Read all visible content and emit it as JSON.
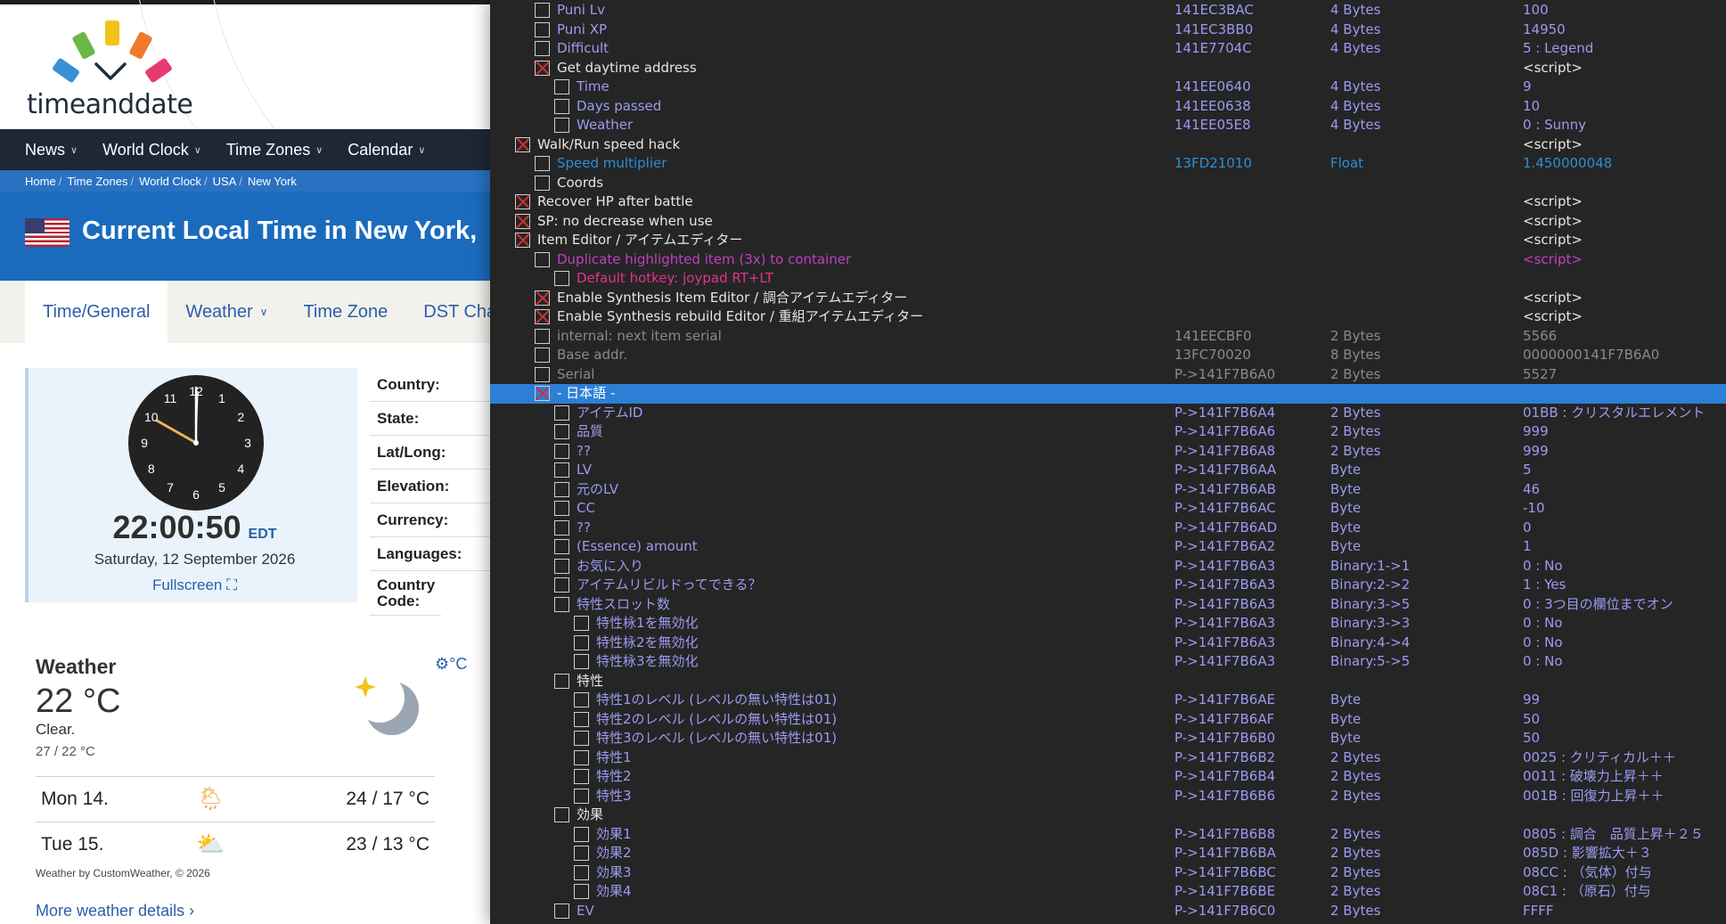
{
  "site": {
    "logo_text": "timeanddate",
    "logo_colors": [
      "#3a8fd6",
      "#6ab84a",
      "#f3c21b",
      "#f0792b",
      "#e63b6f"
    ],
    "nav": [
      "News",
      "World Clock",
      "Time Zones",
      "Calendar"
    ],
    "breadcrumbs": [
      "Home",
      "Time Zones",
      "World Clock",
      "USA",
      "New York"
    ],
    "page_title": "Current Local Time in New York,",
    "tabs": [
      "Time/General",
      "Weather",
      "Time Zone",
      "DST Cha"
    ],
    "clock": {
      "time": "22:00:50",
      "zone": "EDT",
      "date": "Saturday, 12 September 2026",
      "fullscreen": "Fullscreen ⛶",
      "numbers": [
        "12",
        "1",
        "2",
        "3",
        "4",
        "5",
        "6",
        "7",
        "8",
        "9",
        "10",
        "11"
      ]
    },
    "facts": [
      "Country:",
      "State:",
      "Lat/Long:",
      "Elevation:",
      "Currency:",
      "Languages:",
      "Country Code:"
    ],
    "weather": {
      "title": "Weather",
      "temp": "22 °C",
      "desc": "Clear.",
      "range": "27 / 22 °C",
      "unit": "⚙°C",
      "forecast": [
        {
          "day": "Mon 14.",
          "range": "24 / 17 °C",
          "icon": "sun-rain-icon"
        },
        {
          "day": "Tue 15.",
          "range": "23 / 13 °C",
          "icon": "partly-cloudy-icon"
        }
      ],
      "credit": "Weather by CustomWeather, © 2026",
      "more": "More weather details ›"
    }
  },
  "cheat_table": {
    "rows": [
      {
        "indent": 2,
        "checked": false,
        "desc": "Puni Lv",
        "addr": "141EC3BAC",
        "type": "4 Bytes",
        "value": "100",
        "color": "#9b9bf0"
      },
      {
        "indent": 2,
        "checked": false,
        "desc": "Puni XP",
        "addr": "141EC3BB0",
        "type": "4 Bytes",
        "value": "14950",
        "color": "#9b9bf0"
      },
      {
        "indent": 2,
        "checked": false,
        "desc": "Difficult",
        "addr": "141E7704C",
        "type": "4 Bytes",
        "value": "5 : Legend",
        "color": "#9b9bf0"
      },
      {
        "indent": 2,
        "checked": true,
        "desc": "Get daytime address",
        "addr": "",
        "type": "",
        "value": "<script>",
        "color": "#e6e6e6"
      },
      {
        "indent": 3,
        "checked": false,
        "desc": "Time",
        "addr": "141EE0640",
        "type": "4 Bytes",
        "value": "9",
        "color": "#9b9bf0"
      },
      {
        "indent": 3,
        "checked": false,
        "desc": "Days passed",
        "addr": "141EE0638",
        "type": "4 Bytes",
        "value": "10",
        "color": "#9b9bf0"
      },
      {
        "indent": 3,
        "checked": false,
        "desc": "Weather",
        "addr": "141EE05E8",
        "type": "4 Bytes",
        "value": "0 : Sunny",
        "color": "#9b9bf0"
      },
      {
        "indent": 1,
        "checked": true,
        "desc": "Walk/Run speed hack",
        "addr": "",
        "type": "",
        "value": "<script>",
        "color": "#e6e6e6"
      },
      {
        "indent": 2,
        "checked": false,
        "desc": "Speed multiplier",
        "addr": "13FD21010",
        "type": "Float",
        "value": "1.450000048",
        "color": "#2b8fd6"
      },
      {
        "indent": 2,
        "checked": false,
        "desc": "Coords",
        "addr": "",
        "type": "",
        "value": "",
        "color": "#e6e6e6"
      },
      {
        "indent": 1,
        "checked": true,
        "desc": "Recover HP after battle",
        "addr": "",
        "type": "",
        "value": "<script>",
        "color": "#e6e6e6"
      },
      {
        "indent": 1,
        "checked": true,
        "desc": "SP: no decrease when use",
        "addr": "",
        "type": "",
        "value": "<script>",
        "color": "#e6e6e6"
      },
      {
        "indent": 1,
        "checked": true,
        "desc": "Item Editor / アイテムエディター",
        "addr": "",
        "type": "",
        "value": "<script>",
        "color": "#e6e6e6"
      },
      {
        "indent": 2,
        "checked": false,
        "desc": "Duplicate highlighted item (3x) to container",
        "addr": "",
        "type": "",
        "value": "<script>",
        "color": "#c03fc3"
      },
      {
        "indent": 3,
        "checked": false,
        "desc": "Default hotkey: joypad RT+LT",
        "addr": "",
        "type": "",
        "value": "",
        "color": "#e0338a"
      },
      {
        "indent": 2,
        "checked": true,
        "desc": "Enable Synthesis Item Editor / 調合アイテムエディター",
        "addr": "",
        "type": "",
        "value": "<script>",
        "color": "#e6e6e6"
      },
      {
        "indent": 2,
        "checked": true,
        "desc": "Enable Synthesis rebuild Editor / 重組アイテムエディター",
        "addr": "",
        "type": "",
        "value": "<script>",
        "color": "#e6e6e6"
      },
      {
        "indent": 2,
        "checked": false,
        "desc": "internal: next item serial",
        "addr": "141EECBF0",
        "type": "2 Bytes",
        "value": "5566",
        "color": "#8a8a8a"
      },
      {
        "indent": 2,
        "checked": false,
        "desc": "Base addr.",
        "addr": "13FC70020",
        "type": "8 Bytes",
        "value": "0000000141F7B6A0",
        "color": "#8a8a8a"
      },
      {
        "indent": 2,
        "checked": false,
        "desc": "Serial",
        "addr": "P->141F7B6A0",
        "type": "2 Bytes",
        "value": "5527",
        "color": "#8a8a8a"
      },
      {
        "indent": 2,
        "checked": true,
        "desc": "- 日本語 -",
        "addr": "",
        "type": "",
        "value": "",
        "color": "#ffffff",
        "selected": true
      },
      {
        "indent": 3,
        "checked": false,
        "desc": "アイテムID",
        "addr": "P->141F7B6A4",
        "type": "2 Bytes",
        "value": "01BB : クリスタルエレメント",
        "color": "#9b9bf0"
      },
      {
        "indent": 3,
        "checked": false,
        "desc": "品質",
        "addr": "P->141F7B6A6",
        "type": "2 Bytes",
        "value": "999",
        "color": "#9b9bf0"
      },
      {
        "indent": 3,
        "checked": false,
        "desc": "??",
        "addr": "P->141F7B6A8",
        "type": "2 Bytes",
        "value": "999",
        "color": "#9b9bf0"
      },
      {
        "indent": 3,
        "checked": false,
        "desc": "LV",
        "addr": "P->141F7B6AA",
        "type": "Byte",
        "value": "5",
        "color": "#9b9bf0"
      },
      {
        "indent": 3,
        "checked": false,
        "desc": "元のLV",
        "addr": "P->141F7B6AB",
        "type": "Byte",
        "value": "46",
        "color": "#9b9bf0"
      },
      {
        "indent": 3,
        "checked": false,
        "desc": "CC",
        "addr": "P->141F7B6AC",
        "type": "Byte",
        "value": "-10",
        "color": "#9b9bf0"
      },
      {
        "indent": 3,
        "checked": false,
        "desc": "??",
        "addr": "P->141F7B6AD",
        "type": "Byte",
        "value": "0",
        "color": "#9b9bf0"
      },
      {
        "indent": 3,
        "checked": false,
        "desc": "(Essence) amount",
        "addr": "P->141F7B6A2",
        "type": "Byte",
        "value": "1",
        "color": "#9b9bf0"
      },
      {
        "indent": 3,
        "checked": false,
        "desc": "お気に入り",
        "addr": "P->141F7B6A3",
        "type": "Binary:1->1",
        "value": "0 : No",
        "color": "#9b9bf0"
      },
      {
        "indent": 3,
        "checked": false,
        "desc": "アイテムリビルドってできる？",
        "addr": "P->141F7B6A3",
        "type": "Binary:2->2",
        "value": "1 : Yes",
        "color": "#9b9bf0"
      },
      {
        "indent": 3,
        "checked": false,
        "desc": "特性スロット数",
        "addr": "P->141F7B6A3",
        "type": "Binary:3->5",
        "value": "0 : 3つ目の欄位までオン",
        "color": "#9b9bf0"
      },
      {
        "indent": 4,
        "checked": false,
        "desc": "特性栐1を無効化",
        "addr": "P->141F7B6A3",
        "type": "Binary:3->3",
        "value": "0 : No",
        "color": "#9b9bf0"
      },
      {
        "indent": 4,
        "checked": false,
        "desc": "特性栐2を無効化",
        "addr": "P->141F7B6A3",
        "type": "Binary:4->4",
        "value": "0 : No",
        "color": "#9b9bf0"
      },
      {
        "indent": 4,
        "checked": false,
        "desc": "特性栐3を無効化",
        "addr": "P->141F7B6A3",
        "type": "Binary:5->5",
        "value": "0 : No",
        "color": "#9b9bf0"
      },
      {
        "indent": 3,
        "checked": false,
        "desc": "特性",
        "addr": "",
        "type": "",
        "value": "",
        "color": "#e6e6e6"
      },
      {
        "indent": 4,
        "checked": false,
        "desc": "特性1のレベル (レベルの無い特性は01)",
        "addr": "P->141F7B6AE",
        "type": "Byte",
        "value": "99",
        "color": "#9b9bf0"
      },
      {
        "indent": 4,
        "checked": false,
        "desc": "特性2のレベル (レベルの無い特性は01)",
        "addr": "P->141F7B6AF",
        "type": "Byte",
        "value": "50",
        "color": "#9b9bf0"
      },
      {
        "indent": 4,
        "checked": false,
        "desc": "特性3のレベル (レベルの無い特性は01)",
        "addr": "P->141F7B6B0",
        "type": "Byte",
        "value": "50",
        "color": "#9b9bf0"
      },
      {
        "indent": 4,
        "checked": false,
        "desc": "特性1",
        "addr": "P->141F7B6B2",
        "type": "2 Bytes",
        "value": "0025 : クリティカル＋＋",
        "color": "#9b9bf0"
      },
      {
        "indent": 4,
        "checked": false,
        "desc": "特性2",
        "addr": "P->141F7B6B4",
        "type": "2 Bytes",
        "value": "0011 : 破壊力上昇＋＋",
        "color": "#9b9bf0"
      },
      {
        "indent": 4,
        "checked": false,
        "desc": "特性3",
        "addr": "P->141F7B6B6",
        "type": "2 Bytes",
        "value": "001B : 回復力上昇＋＋",
        "color": "#9b9bf0"
      },
      {
        "indent": 3,
        "checked": false,
        "desc": "効果",
        "addr": "",
        "type": "",
        "value": "",
        "color": "#e6e6e6"
      },
      {
        "indent": 4,
        "checked": false,
        "desc": "効果1",
        "addr": "P->141F7B6B8",
        "type": "2 Bytes",
        "value": "0805 : 調合　品質上昇＋２５",
        "color": "#9b9bf0"
      },
      {
        "indent": 4,
        "checked": false,
        "desc": "効果2",
        "addr": "P->141F7B6BA",
        "type": "2 Bytes",
        "value": "085D : 影響拡大＋３",
        "color": "#9b9bf0"
      },
      {
        "indent": 4,
        "checked": false,
        "desc": "効果3",
        "addr": "P->141F7B6BC",
        "type": "2 Bytes",
        "value": "08CC : （気体）付与",
        "color": "#9b9bf0"
      },
      {
        "indent": 4,
        "checked": false,
        "desc": "効果4",
        "addr": "P->141F7B6BE",
        "type": "2 Bytes",
        "value": "08C1 : （原石）付与",
        "color": "#9b9bf0"
      },
      {
        "indent": 3,
        "checked": false,
        "desc": "EV",
        "addr": "P->141F7B6C0",
        "type": "2 Bytes",
        "value": "FFFF",
        "color": "#9b9bf0"
      }
    ]
  }
}
